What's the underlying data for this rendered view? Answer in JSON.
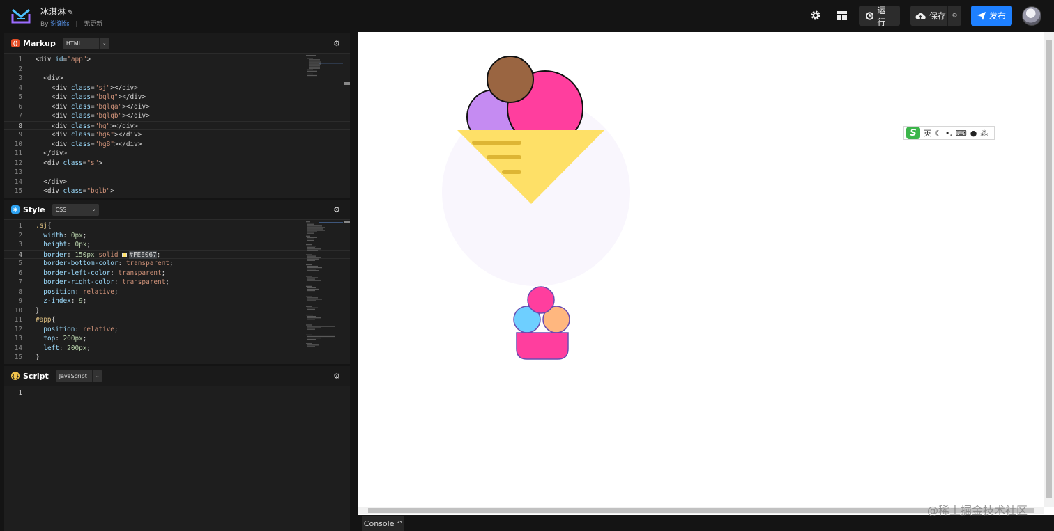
{
  "header": {
    "title": "冰淇淋",
    "by_prefix": "By",
    "author": "谢谢你",
    "status": "无更新",
    "run_label": "运行",
    "save_label": "保存",
    "publish_label": "发布",
    "icons": [
      "settings-icon",
      "layout-icon",
      "run-icon",
      "cloud-upload-icon",
      "send-icon"
    ]
  },
  "panels": {
    "markup": {
      "title": "Markup",
      "lang": "HTML"
    },
    "style": {
      "title": "Style",
      "lang": "CSS"
    },
    "script": {
      "title": "Script",
      "lang": "JavaScript"
    }
  },
  "markup_lines": [
    {
      "n": "1",
      "code": "<div id=\"app\">"
    },
    {
      "n": "2",
      "code": ""
    },
    {
      "n": "3",
      "code": "  <div>"
    },
    {
      "n": "4",
      "code": "    <div class=\"sj\"></div>"
    },
    {
      "n": "5",
      "code": "    <div class=\"bqlq\"></div>"
    },
    {
      "n": "6",
      "code": "    <div class=\"bqlqa\"></div>"
    },
    {
      "n": "7",
      "code": "    <div class=\"bqlqb\"></div>"
    },
    {
      "n": "8",
      "code": "    <div class=\"hg\"></div>"
    },
    {
      "n": "9",
      "code": "    <div class=\"hgA\"></div>"
    },
    {
      "n": "10",
      "code": "    <div class=\"hgB\"></div>"
    },
    {
      "n": "11",
      "code": "  </div>"
    },
    {
      "n": "12",
      "code": "  <div class=\"s\">"
    },
    {
      "n": "13",
      "code": ""
    },
    {
      "n": "14",
      "code": "  </div>"
    },
    {
      "n": "15",
      "code": "  <div class=\"bqlb\">"
    }
  ],
  "style_lines": [
    {
      "n": "1",
      "code": ".sj{"
    },
    {
      "n": "2",
      "code": "  width: 0px;"
    },
    {
      "n": "3",
      "code": "  height: 0px;"
    },
    {
      "n": "4",
      "code": "  border: 150px solid #FEE067;"
    },
    {
      "n": "5",
      "code": "  border-bottom-color: transparent;"
    },
    {
      "n": "6",
      "code": "  border-left-color: transparent;"
    },
    {
      "n": "7",
      "code": "  border-right-color: transparent;"
    },
    {
      "n": "8",
      "code": "  position: relative;"
    },
    {
      "n": "9",
      "code": "  z-index: 9;"
    },
    {
      "n": "10",
      "code": "}"
    },
    {
      "n": "11",
      "code": "#app{"
    },
    {
      "n": "12",
      "code": "  position: relative;"
    },
    {
      "n": "13",
      "code": "  top: 200px;"
    },
    {
      "n": "14",
      "code": "  left: 200px;"
    },
    {
      "n": "15",
      "code": "}"
    }
  ],
  "script_lines": [
    {
      "n": "1",
      "code": ""
    }
  ],
  "colors": {
    "cone_yellow": "#FEE067",
    "cone_stripe": "#DDB534",
    "scoop_pink": "#FF3E9E",
    "scoop_purple": "#C58BF2",
    "scoop_brown": "#9A6541",
    "halo": "#F9F6FD",
    "small_blue": "#6ECFFF",
    "small_orange": "#FFB77F",
    "accent_blue": "#1E80FF"
  },
  "ime": {
    "lang": "英"
  },
  "console": {
    "label": "Console ^"
  },
  "watermark": "@稀土掘金技术社区"
}
